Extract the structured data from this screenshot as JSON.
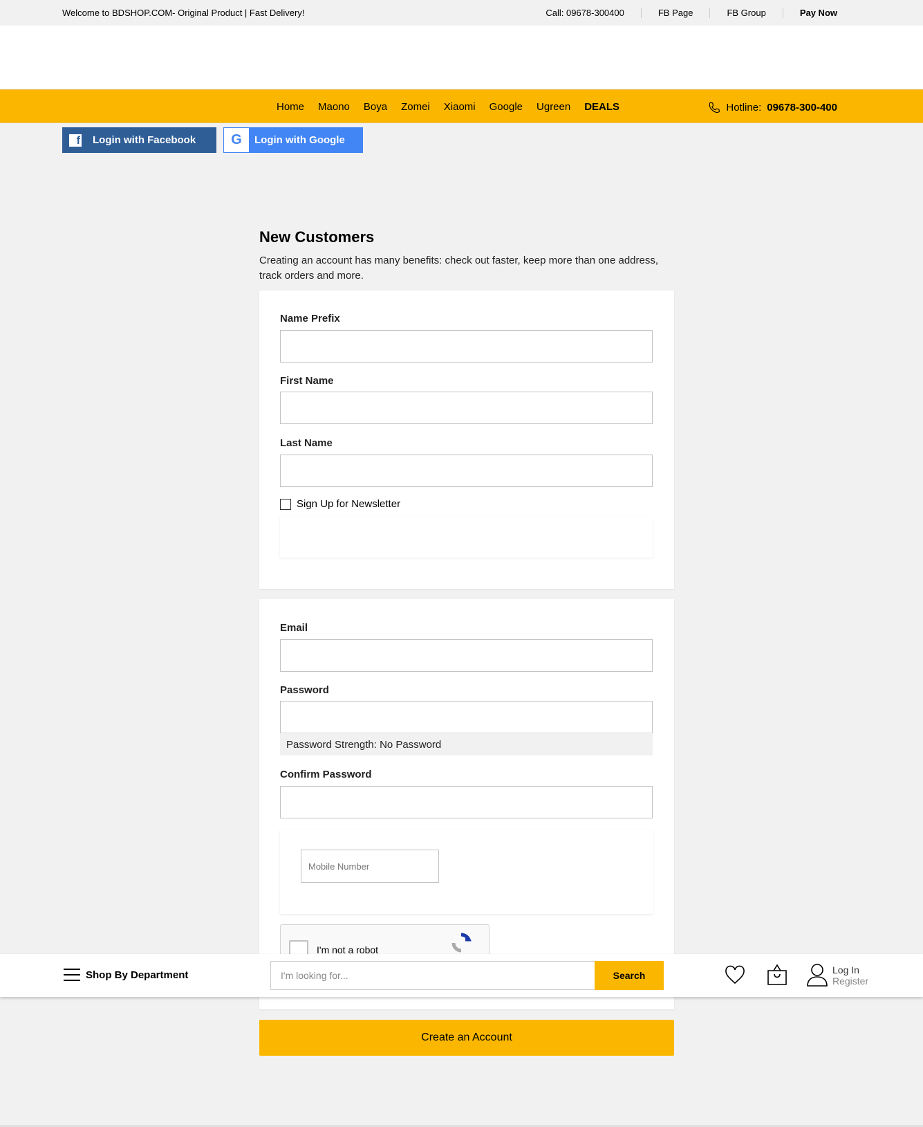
{
  "topbar": {
    "welcome": "Welcome to BDSHOP.COM- Original Product | Fast Delivery!",
    "links": [
      "Call: 09678-300400",
      "FB Page",
      "FB Group",
      "Pay Now"
    ]
  },
  "nav": {
    "items": [
      "Home",
      "Maono",
      "Boya",
      "Zomei",
      "Xiaomi",
      "Google",
      "Ugreen",
      "DEALS"
    ],
    "hotline_label": "Hotline:",
    "hotline_number": "09678-300-400"
  },
  "social": {
    "facebook": "Login with Facebook",
    "google": "Login with Google"
  },
  "form": {
    "title": "New Customers",
    "intro": "Creating an account has many benefits: check out faster, keep more than one address, track orders and more.",
    "name_prefix": "Name Prefix",
    "first_name": "First Name",
    "last_name": "Last Name",
    "newsletter": "Sign Up for Newsletter",
    "email": "Email",
    "password": "Password",
    "strength": "Password Strength: No Password",
    "confirm": "Confirm Password",
    "mobile_placeholder": "Mobile Number",
    "captcha": "I'm not a robot",
    "submit": "Create an Account"
  },
  "sticky": {
    "department": "Shop By Department",
    "search_placeholder": "I'm looking for...",
    "search_button": "Search",
    "login": "Log In",
    "register": "Register"
  },
  "colors": {
    "accent": "#fbb700",
    "facebook": "#2f5e97",
    "google": "#4285f4"
  }
}
